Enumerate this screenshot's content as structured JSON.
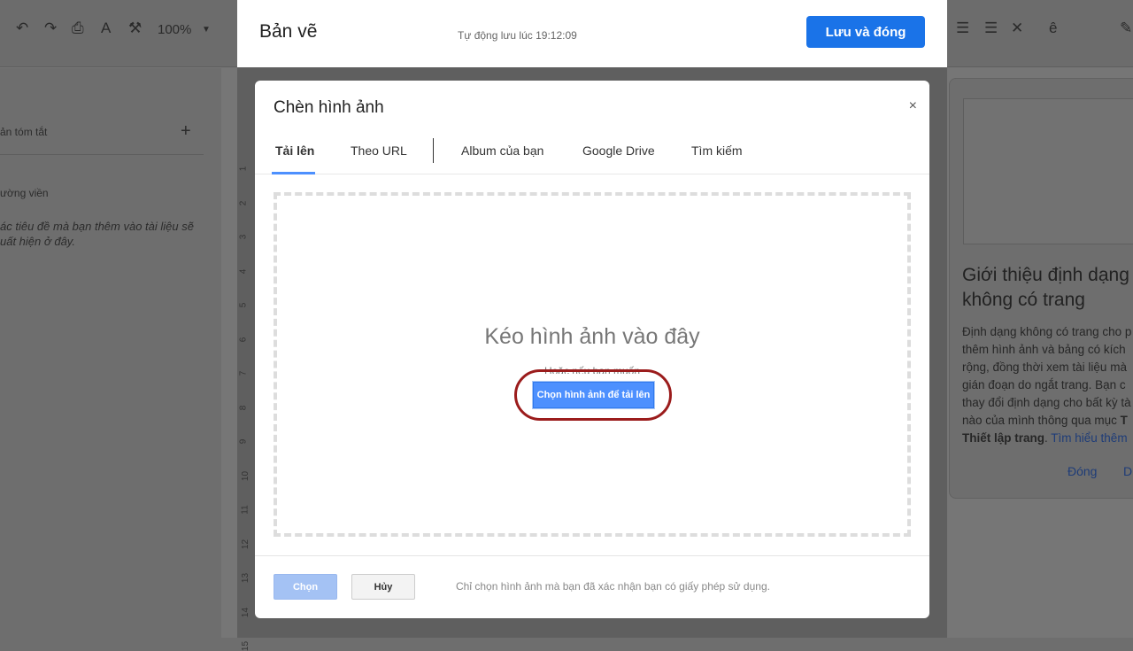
{
  "background": {
    "toolbar": {
      "zoom": "100%",
      "icons": [
        "undo-icon",
        "redo-icon",
        "print-icon",
        "spellcheck-icon",
        "paint-format-icon"
      ],
      "right_icons": [
        "decrease-indent-icon",
        "increase-indent-icon",
        "clear-format-icon",
        "input-tools-icon",
        "pencil-icon"
      ],
      "input_tool": "ê"
    },
    "sidebar": {
      "summary": "ản tóm tắt",
      "outline": "ường viền",
      "outline_hint_1": "ác tiêu đề mà bạn thêm vào tài liệu sẽ",
      "outline_hint_2": "uất hiện ở đây."
    },
    "ruler": [
      "1",
      "2",
      "3",
      "4",
      "5",
      "6",
      "7",
      "8",
      "9",
      "10",
      "11",
      "12",
      "13",
      "14",
      "15"
    ],
    "panel": {
      "title_1": "Giới thiệu định dạng",
      "title_2": "không có trang",
      "lines": [
        "Định dạng không có trang cho p",
        "thêm hình ảnh và bảng có kích",
        "rộng, đồng thời xem tài liệu mà",
        "gián đoạn do ngắt trang. Bạn c",
        "thay đổi định dạng cho bất kỳ tà"
      ],
      "line_6": "nào của mình thông qua mục ",
      "line_6_bold": "T",
      "line_7_bold": "Thiết lập trang",
      "line_7_rest": ". ",
      "learn_more": "Tìm hiểu thêm",
      "close": "Đóng",
      "other": "D"
    }
  },
  "drawing": {
    "title": "Bản vẽ",
    "autosave": "Tự động lưu lúc 19:12:09",
    "save_close": "Lưu và đóng"
  },
  "dialog": {
    "title": "Chèn hình ảnh",
    "close": "×",
    "tabs": [
      {
        "label": "Tải lên",
        "active": true
      },
      {
        "label": "Theo URL"
      },
      {
        "label": "Album của bạn"
      },
      {
        "label": "Google Drive"
      },
      {
        "label": "Tìm kiếm"
      }
    ],
    "drop_title": "Kéo hình ảnh vào đây",
    "or_text": "Hoặc nếu bạn muốn",
    "pick_button": "Chọn hình ảnh để tải lên",
    "select_button": "Chọn",
    "cancel_button": "Hủy",
    "note": "Chỉ chọn hình ảnh mà bạn đã xác nhận bạn có giấy phép sử dụng."
  },
  "colors": {
    "primary": "#1a73e8",
    "highlight_ring": "#9b1c1c",
    "upload_button": "#4d90fe"
  }
}
